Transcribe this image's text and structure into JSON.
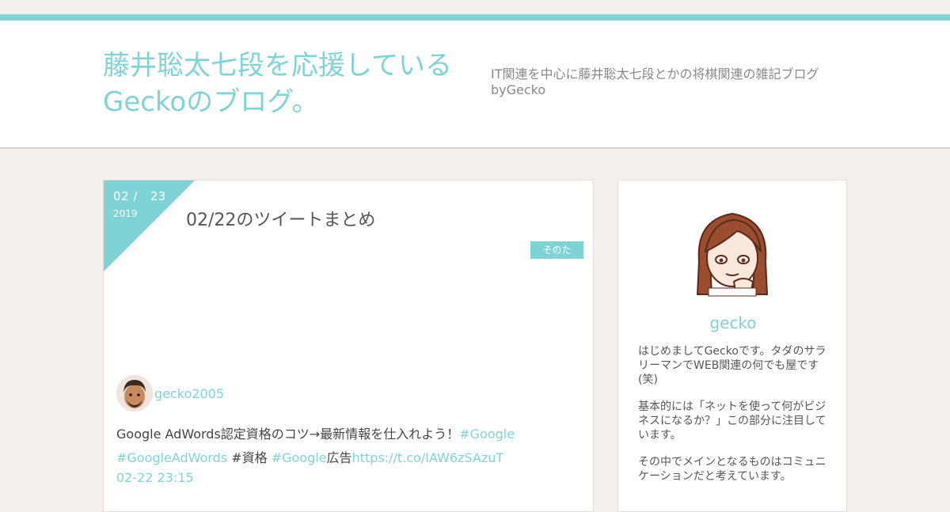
{
  "header": {
    "title": "藤井聡太七段を応援しているGeckoのブログ。",
    "description": "IT関連を中心に藤井聡太七段とかの将棋関連の雑記ブログbyGecko"
  },
  "post": {
    "date_month_day": "02 /   23",
    "date_year": "2019",
    "title": "02/22のツイートまとめ",
    "category": "そのた",
    "tweet": {
      "username": "gecko2005",
      "text_1": "Google AdWords認定資格のコツ→最新情報を仕入れよう！",
      "hashtag_google_1": "#Google",
      "hashtag_adwords": "#GoogleAdWords",
      "text_2": " #資格 ",
      "hashtag_google_2": "#Google",
      "text_3": "広告",
      "link": "https://t.co/IAW6zSAzuT",
      "time": "02-22 23:15"
    }
  },
  "sidebar": {
    "name": "gecko",
    "paragraphs": [
      "はじめましてGeckoです。タダのサラリーマンでWEB関連の何でも屋です(笑)",
      "基本的には「ネットを使って何がビジネスになるか？」この部分に注目しています。",
      "その中でメインとなるものはコミュニケーションだと考えています。"
    ]
  },
  "colors": {
    "accent": "#7fd3d7",
    "background": "#f5f0ec",
    "card": "#ffffff"
  },
  "icons": {
    "profile": "cartoon-avatar-icon",
    "tweet_user": "user-avatar-icon"
  }
}
